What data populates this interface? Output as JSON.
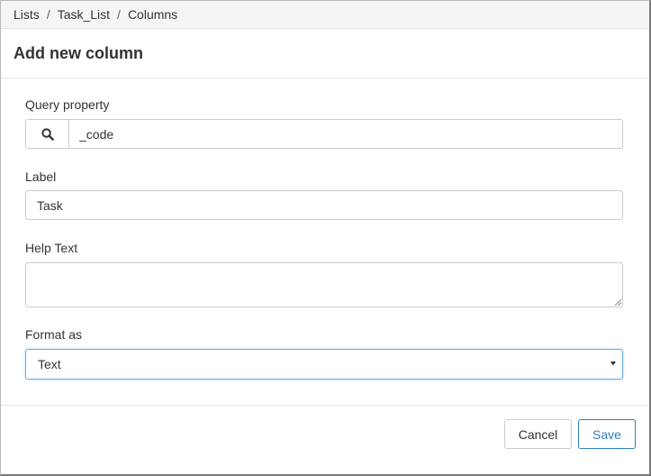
{
  "breadcrumb": {
    "items": [
      "Lists",
      "Task_List",
      "Columns"
    ],
    "separator": "/"
  },
  "modal": {
    "title": "Add new column"
  },
  "form": {
    "query_property": {
      "label": "Query property",
      "value": "_code",
      "icon": "search-icon"
    },
    "label_field": {
      "label": "Label",
      "value": "Task"
    },
    "help_text": {
      "label": "Help Text",
      "value": ""
    },
    "format_as": {
      "label": "Format as",
      "selected": "Text",
      "icon": "caret-down-icon"
    }
  },
  "footer": {
    "cancel_label": "Cancel",
    "save_label": "Save"
  },
  "colors": {
    "primary": "#2e7fbe",
    "focus_border": "#66afe9",
    "border": "#cccccc",
    "breadcrumb_bg": "#f5f5f5"
  }
}
